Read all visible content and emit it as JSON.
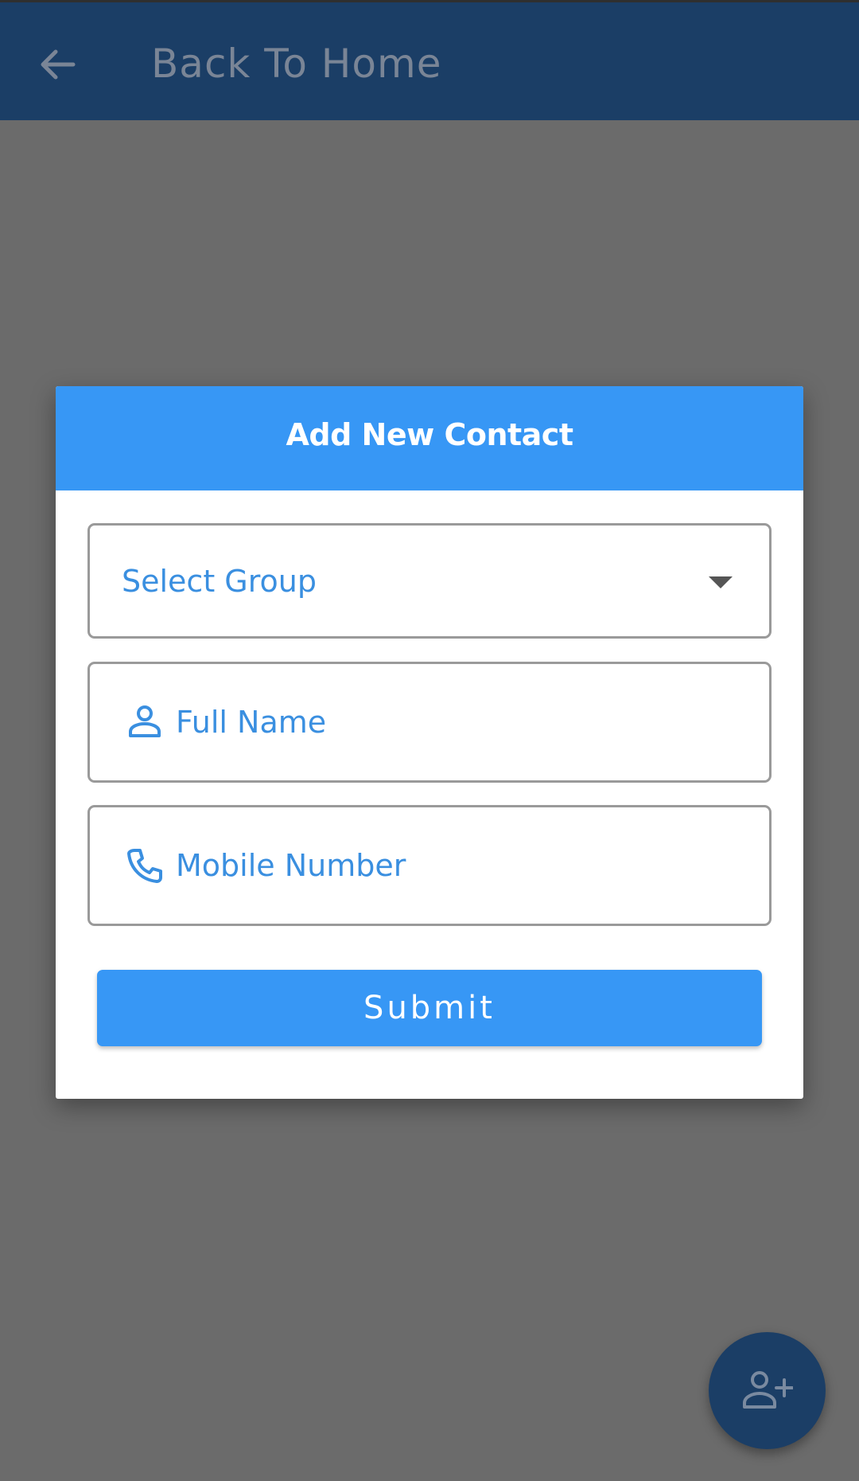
{
  "topbar": {
    "back_icon": "arrow-back-icon",
    "title": "Back To Home"
  },
  "dialog": {
    "title": "Add New Contact",
    "group_select": {
      "value": "Select Group",
      "icon": "dropdown-arrow-icon"
    },
    "full_name": {
      "placeholder": "Full Name",
      "icon": "person-icon"
    },
    "mobile": {
      "placeholder": "Mobile Number",
      "icon": "phone-icon"
    },
    "submit_label": "Submit"
  },
  "fab": {
    "icon": "add-person-icon"
  },
  "colors": {
    "topbar": "#1b3e66",
    "accent": "#3797f5",
    "overlay": "#6b6b6b",
    "field_text": "#3a8fe0"
  }
}
